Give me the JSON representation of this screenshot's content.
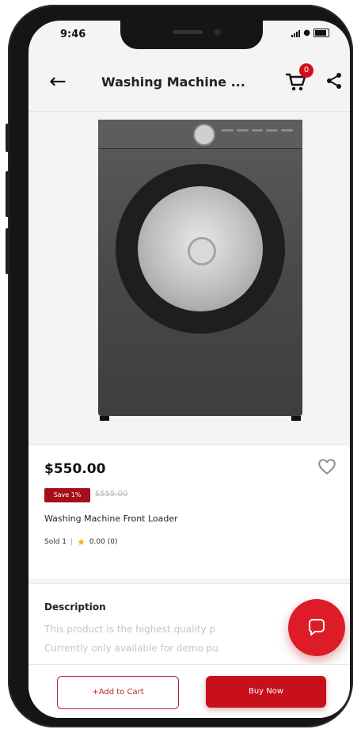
{
  "status_bar": {
    "time": "9:46"
  },
  "header": {
    "title": "Washing Machine ...",
    "cart_count": "0",
    "icons": [
      "back-arrow-icon",
      "cart-icon",
      "share-icon"
    ]
  },
  "product": {
    "image": "washing-machine-front-loader-image",
    "price": "$550.00",
    "save_badge": "Save 1%",
    "old_price": "$555.00",
    "name": "Washing Machine Front Loader",
    "sold": "Sold 1",
    "separator": "|",
    "rating": "0.00 (0)"
  },
  "description": {
    "title": "Description",
    "line1": "This product is the highest quality p",
    "line2": "Currently only available for demo pu"
  },
  "actions": {
    "add_to_cart": "+Add to Cart",
    "buy_now": "Buy Now"
  },
  "colors": {
    "accent": "#c8101d",
    "badge": "#a50f1a",
    "star": "#f1b400"
  }
}
